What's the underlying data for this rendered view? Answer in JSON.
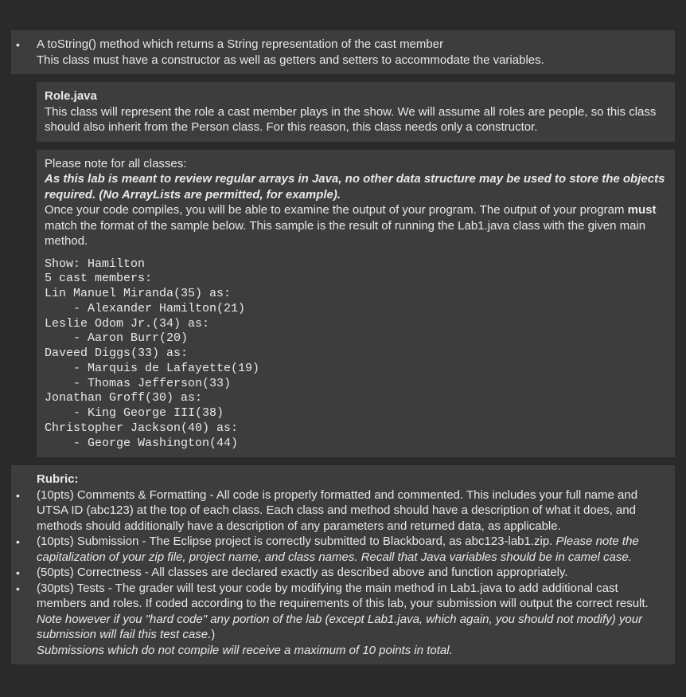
{
  "section1": {
    "line1": "A toString() method which returns a String representation of the cast member",
    "line2": "This class must have a constructor as well as getters and setters to accommodate the variables."
  },
  "section2": {
    "title": "Role.java",
    "desc": "This class will represent the role a cast member plays in the show. We will assume all roles are people, so this class should also inherit from the Person class. For this reason, this class needs only a constructor."
  },
  "section3": {
    "note_label": "Please note for all classes:",
    "emph": "As this lab is meant to review regular arrays in Java, no other data structure may be used to store the objects required. (No ArrayLists are permitted, for example).",
    "compile_pre": "Once your code compiles, you will be able to examine the output of your program. The output of your program ",
    "must": "must",
    "compile_post": " match the format of the sample below. This sample is the result of running the Lab1.java class with the given main method.",
    "code": "Show: Hamilton\n5 cast members:\nLin Manuel Miranda(35) as:\n    - Alexander Hamilton(21)\nLeslie Odom Jr.(34) as:\n    - Aaron Burr(20)\nDaveed Diggs(33) as:\n    - Marquis de Lafayette(19)\n    - Thomas Jefferson(33)\nJonathan Groff(30) as:\n    - King George III(38)\nChristopher Jackson(40) as:\n    - George Washington(44)"
  },
  "rubric": {
    "title": "Rubric:",
    "r1": "(10pts) Comments & Formatting - All code is properly formatted and commented. This includes your full name and UTSA ID (abc123) at the top of each class. Each class and method should have a description of what it does, and methods should additionally have a description of any parameters and returned data, as applicable.",
    "r2_pre": "(10pts) Submission - The Eclipse project is correctly submitted to Blackboard, as abc123-lab1.zip. ",
    "r2_ital": "Please note the capitalization of your zip file, project name, and class names. Recall that Java variables should be in camel case.",
    "r3": "(50pts) Correctness - All classes are declared exactly as described above and function appropriately.",
    "r4_pre": "(30pts) Tests - The grader will test your code by modifying the main method in Lab1.java to add additional cast members and roles. If coded according to the requirements of this lab, your submission will output the correct result. ",
    "r4_ital": "Note however if you \"hard code\" any portion of the lab (except Lab1.java, which again, you should not modify) your submission will fail this test case.",
    "r4_post": ")",
    "r5_ital": "Submissions which do not compile will receive a maximum of 10 points in total."
  }
}
